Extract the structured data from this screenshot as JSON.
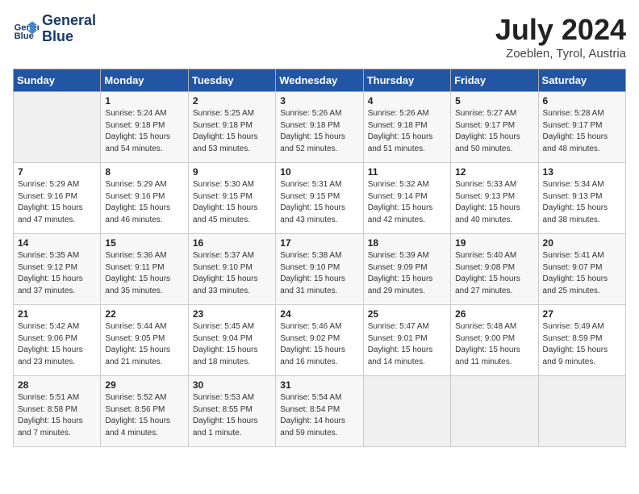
{
  "header": {
    "logo_line1": "General",
    "logo_line2": "Blue",
    "month_title": "July 2024",
    "location": "Zoeblen, Tyrol, Austria"
  },
  "days_of_week": [
    "Sunday",
    "Monday",
    "Tuesday",
    "Wednesday",
    "Thursday",
    "Friday",
    "Saturday"
  ],
  "weeks": [
    [
      {
        "num": "",
        "info": ""
      },
      {
        "num": "1",
        "info": "Sunrise: 5:24 AM\nSunset: 9:18 PM\nDaylight: 15 hours\nand 54 minutes."
      },
      {
        "num": "2",
        "info": "Sunrise: 5:25 AM\nSunset: 9:18 PM\nDaylight: 15 hours\nand 53 minutes."
      },
      {
        "num": "3",
        "info": "Sunrise: 5:26 AM\nSunset: 9:18 PM\nDaylight: 15 hours\nand 52 minutes."
      },
      {
        "num": "4",
        "info": "Sunrise: 5:26 AM\nSunset: 9:18 PM\nDaylight: 15 hours\nand 51 minutes."
      },
      {
        "num": "5",
        "info": "Sunrise: 5:27 AM\nSunset: 9:17 PM\nDaylight: 15 hours\nand 50 minutes."
      },
      {
        "num": "6",
        "info": "Sunrise: 5:28 AM\nSunset: 9:17 PM\nDaylight: 15 hours\nand 48 minutes."
      }
    ],
    [
      {
        "num": "7",
        "info": "Sunrise: 5:29 AM\nSunset: 9:16 PM\nDaylight: 15 hours\nand 47 minutes."
      },
      {
        "num": "8",
        "info": "Sunrise: 5:29 AM\nSunset: 9:16 PM\nDaylight: 15 hours\nand 46 minutes."
      },
      {
        "num": "9",
        "info": "Sunrise: 5:30 AM\nSunset: 9:15 PM\nDaylight: 15 hours\nand 45 minutes."
      },
      {
        "num": "10",
        "info": "Sunrise: 5:31 AM\nSunset: 9:15 PM\nDaylight: 15 hours\nand 43 minutes."
      },
      {
        "num": "11",
        "info": "Sunrise: 5:32 AM\nSunset: 9:14 PM\nDaylight: 15 hours\nand 42 minutes."
      },
      {
        "num": "12",
        "info": "Sunrise: 5:33 AM\nSunset: 9:13 PM\nDaylight: 15 hours\nand 40 minutes."
      },
      {
        "num": "13",
        "info": "Sunrise: 5:34 AM\nSunset: 9:13 PM\nDaylight: 15 hours\nand 38 minutes."
      }
    ],
    [
      {
        "num": "14",
        "info": "Sunrise: 5:35 AM\nSunset: 9:12 PM\nDaylight: 15 hours\nand 37 minutes."
      },
      {
        "num": "15",
        "info": "Sunrise: 5:36 AM\nSunset: 9:11 PM\nDaylight: 15 hours\nand 35 minutes."
      },
      {
        "num": "16",
        "info": "Sunrise: 5:37 AM\nSunset: 9:10 PM\nDaylight: 15 hours\nand 33 minutes."
      },
      {
        "num": "17",
        "info": "Sunrise: 5:38 AM\nSunset: 9:10 PM\nDaylight: 15 hours\nand 31 minutes."
      },
      {
        "num": "18",
        "info": "Sunrise: 5:39 AM\nSunset: 9:09 PM\nDaylight: 15 hours\nand 29 minutes."
      },
      {
        "num": "19",
        "info": "Sunrise: 5:40 AM\nSunset: 9:08 PM\nDaylight: 15 hours\nand 27 minutes."
      },
      {
        "num": "20",
        "info": "Sunrise: 5:41 AM\nSunset: 9:07 PM\nDaylight: 15 hours\nand 25 minutes."
      }
    ],
    [
      {
        "num": "21",
        "info": "Sunrise: 5:42 AM\nSunset: 9:06 PM\nDaylight: 15 hours\nand 23 minutes."
      },
      {
        "num": "22",
        "info": "Sunrise: 5:44 AM\nSunset: 9:05 PM\nDaylight: 15 hours\nand 21 minutes."
      },
      {
        "num": "23",
        "info": "Sunrise: 5:45 AM\nSunset: 9:04 PM\nDaylight: 15 hours\nand 18 minutes."
      },
      {
        "num": "24",
        "info": "Sunrise: 5:46 AM\nSunset: 9:02 PM\nDaylight: 15 hours\nand 16 minutes."
      },
      {
        "num": "25",
        "info": "Sunrise: 5:47 AM\nSunset: 9:01 PM\nDaylight: 15 hours\nand 14 minutes."
      },
      {
        "num": "26",
        "info": "Sunrise: 5:48 AM\nSunset: 9:00 PM\nDaylight: 15 hours\nand 11 minutes."
      },
      {
        "num": "27",
        "info": "Sunrise: 5:49 AM\nSunset: 8:59 PM\nDaylight: 15 hours\nand 9 minutes."
      }
    ],
    [
      {
        "num": "28",
        "info": "Sunrise: 5:51 AM\nSunset: 8:58 PM\nDaylight: 15 hours\nand 7 minutes."
      },
      {
        "num": "29",
        "info": "Sunrise: 5:52 AM\nSunset: 8:56 PM\nDaylight: 15 hours\nand 4 minutes."
      },
      {
        "num": "30",
        "info": "Sunrise: 5:53 AM\nSunset: 8:55 PM\nDaylight: 15 hours\nand 1 minute."
      },
      {
        "num": "31",
        "info": "Sunrise: 5:54 AM\nSunset: 8:54 PM\nDaylight: 14 hours\nand 59 minutes."
      },
      {
        "num": "",
        "info": ""
      },
      {
        "num": "",
        "info": ""
      },
      {
        "num": "",
        "info": ""
      }
    ]
  ]
}
